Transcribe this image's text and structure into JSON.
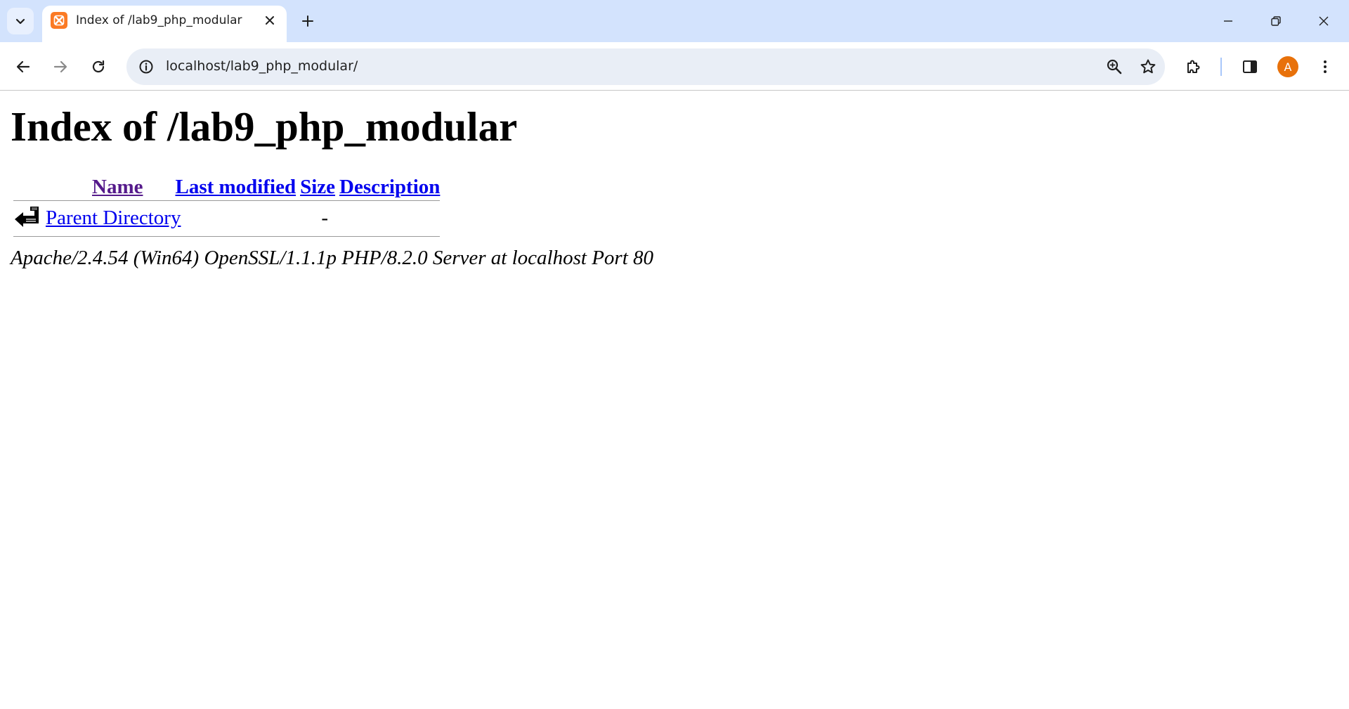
{
  "browser": {
    "tab_title": "Index of /lab9_php_modular",
    "address_url": "localhost/lab9_php_modular/",
    "profile_initial": "A",
    "accent_colors": {
      "tabstrip_bg": "#d3e3fd",
      "omnibox_bg": "#e9eef6",
      "favicon": "#fb7a24",
      "avatar": "#e8710a"
    }
  },
  "page": {
    "heading": "Index of /lab9_php_modular",
    "columns": {
      "name": "Name",
      "last_modified": "Last modified",
      "size": "Size",
      "description": "Description"
    },
    "rows": [
      {
        "name": "Parent Directory",
        "last_modified": "",
        "size": "-",
        "description": "",
        "icon": "back-arrow-icon"
      }
    ],
    "footer": "Apache/2.4.54 (Win64) OpenSSL/1.1.1p PHP/8.2.0 Server at localhost Port 80"
  }
}
